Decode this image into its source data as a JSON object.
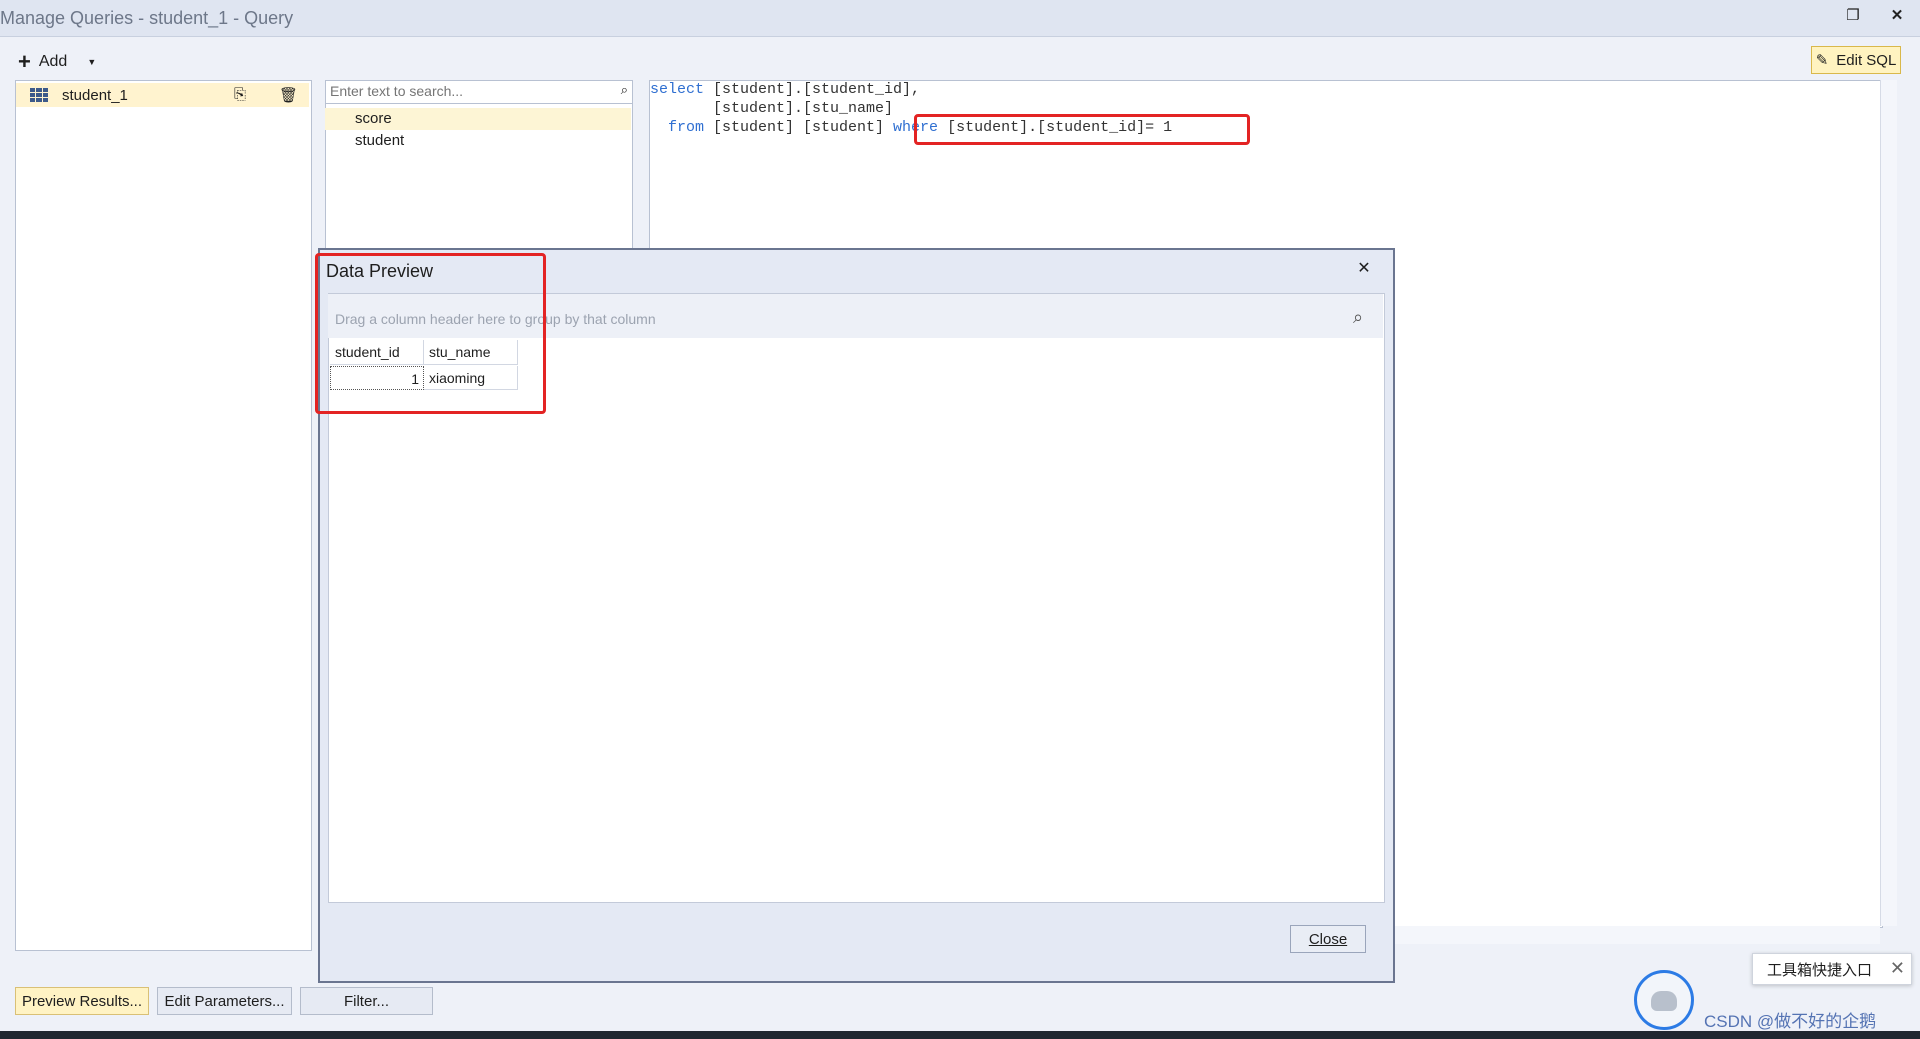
{
  "window": {
    "title": "Manage Queries - student_1 - Query",
    "restore_icon": "restore-icon",
    "close_icon": "close-icon"
  },
  "toolbar": {
    "add_label": "Add",
    "edit_sql_label": "Edit SQL"
  },
  "queries": {
    "items": [
      {
        "label": "student_1"
      }
    ]
  },
  "tables": {
    "search_placeholder": "Enter text to search...",
    "items": [
      {
        "label": "score"
      },
      {
        "label": "student"
      }
    ]
  },
  "sql": {
    "line1_kw": "select",
    "line1_rest": " [student].[student_id],",
    "line2": "       [student].[stu_name]",
    "line3_kw": "  from",
    "line3_rest": " [student] [student] ",
    "line3_where": "where",
    "line3_cond": " [student].[student_id]= 1"
  },
  "dialog": {
    "title": "Data Preview",
    "group_hint": "Drag a column header here to group by that column",
    "columns": [
      "student_id",
      "stu_name"
    ],
    "rows": [
      {
        "student_id": "1",
        "stu_name": "xiaoming"
      }
    ],
    "close_label": "Close"
  },
  "bottom": {
    "preview_label": "Preview Results...",
    "params_label": "Edit Parameters...",
    "filter_label": "Filter..."
  },
  "overlay": {
    "tooltip_text": "工具箱快捷入口",
    "watermark": "CSDN @做不好的企鹅"
  },
  "colors": {
    "highlight_red": "#e32323",
    "selection_yellow": "#fff3cf",
    "keyword_blue": "#2f6fd1"
  }
}
